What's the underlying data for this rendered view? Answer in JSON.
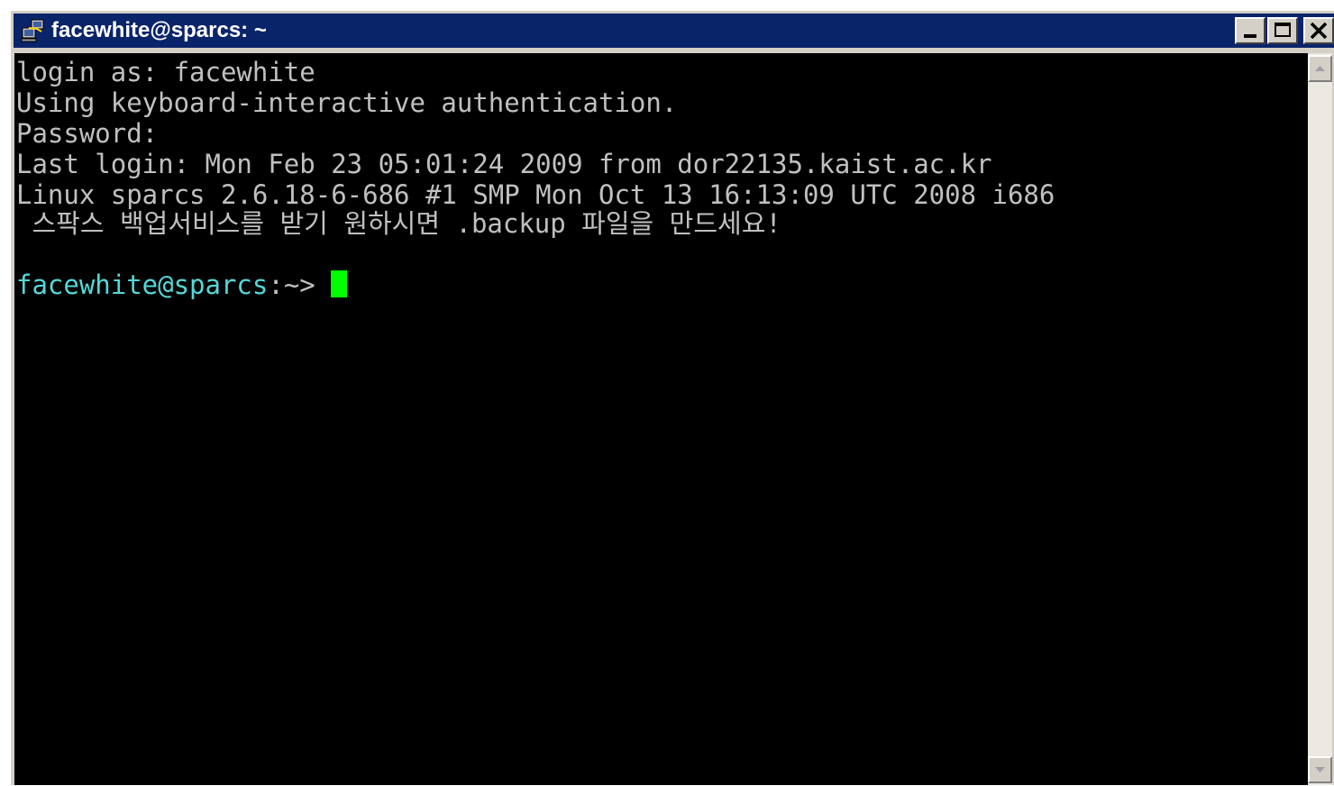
{
  "window": {
    "title": "facewhite@sparcs: ~",
    "icon": "putty-computer-icon",
    "buttons": [
      "minimize",
      "maximize",
      "close"
    ]
  },
  "terminal": {
    "lines": [
      "login as: facewhite",
      "Using keyboard-interactive authentication.",
      "Password:",
      "Last login: Mon Feb 23 05:01:24 2009 from dor22135.kaist.ac.kr",
      "Linux sparcs 2.6.18-6-686 #1 SMP Mon Oct 13 16:13:09 UTC 2008 i686",
      " 스팍스 백업서비스를 받기 원하시면 .backup 파일을 만드세요!"
    ],
    "prompt": {
      "user_host": "facewhite@sparcs",
      "suffix": ":~> "
    },
    "colors": {
      "background": "#000000",
      "text": "#c0c0c0",
      "prompt": "#54d8d8",
      "cursor": "#00ff00"
    }
  }
}
